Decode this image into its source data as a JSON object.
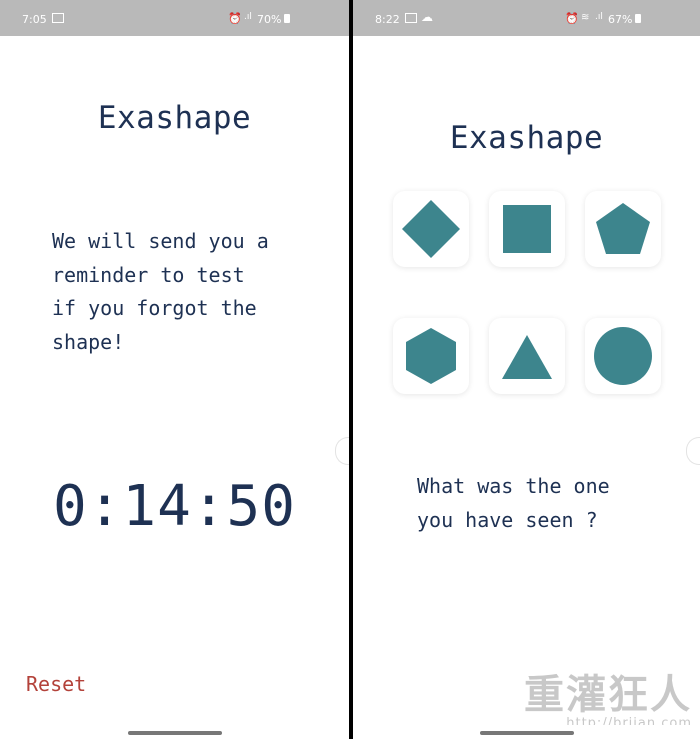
{
  "left_screen": {
    "status": {
      "time": "7:05",
      "battery": "70%"
    },
    "title": "Exashape",
    "message_lines": [
      "We will send you a",
      "reminder to test",
      "if you forgot the",
      "shape!"
    ],
    "timer": "0:14:50",
    "reset_label": "Reset"
  },
  "right_screen": {
    "status": {
      "time": "8:22",
      "battery": "67%"
    },
    "title": "Exashape",
    "shapes": [
      "diamond",
      "square",
      "pentagon",
      "hexagon",
      "triangle",
      "circle"
    ],
    "question_lines": [
      "What was the one",
      "you have seen ?"
    ]
  },
  "watermark": {
    "line1": "重灌狂人",
    "line2": "http://briian.com"
  },
  "colors": {
    "primary_text": "#1e3153",
    "shape_fill": "#3d858d",
    "reset": "#b3423a",
    "statusbar": "#b9b9b9"
  }
}
